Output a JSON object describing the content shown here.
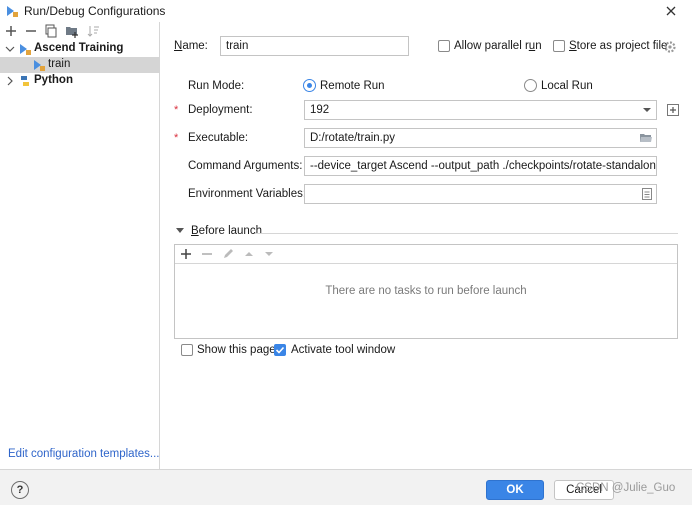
{
  "window": {
    "title": "Run/Debug Configurations"
  },
  "sidebar": {
    "tree": [
      {
        "label": "Ascend Training",
        "expanded": true,
        "children": [
          {
            "label": "train",
            "selected": true
          }
        ]
      },
      {
        "label": "Python",
        "expanded": false
      }
    ],
    "edit_templates_link": "Edit configuration templates..."
  },
  "form": {
    "name_label_mnemonic": "N",
    "name_label_rest": "ame:",
    "name_value": "train",
    "allow_parallel_run_pre": "Allow parallel r",
    "allow_parallel_run_mnemonic": "u",
    "allow_parallel_run_post": "n",
    "allow_parallel_run_checked": false,
    "store_as_project_file_mnemonic": "S",
    "store_as_project_file_rest": "tore as project file",
    "store_as_project_file_checked": false,
    "run_mode_label": "Run Mode:",
    "run_mode_options": [
      "Remote Run",
      "Local Run"
    ],
    "run_mode_selected": "Remote Run",
    "deployment_label": "Deployment:",
    "deployment_value": "192",
    "executable_label": "Executable:",
    "executable_value": "D:/rotate/train.py",
    "command_arguments_label": "Command Arguments:",
    "command_arguments_value": "--device_target Ascend --output_path ./checkpoints/rotate-standalone-as",
    "environment_variables_label": "Environment Variables:",
    "environment_variables_value": "",
    "required_marker": "*"
  },
  "before_launch": {
    "title_mnemonic": "B",
    "title_rest": "efore launch",
    "empty_text": "There are no tasks to run before launch"
  },
  "options": {
    "show_this_page_label": "Show this page",
    "show_this_page_checked": false,
    "activate_tool_window_label": "Activate tool window",
    "activate_tool_window_checked": true
  },
  "footer": {
    "help_label": "?",
    "ok_label": "OK",
    "cancel_label": "Cancel",
    "watermark": "CSDN @Julie_Guo"
  },
  "icons": {
    "app": "run-debug-icon",
    "close": "close-icon",
    "add": "plus-icon",
    "remove": "minus-icon",
    "copy": "copy-icon",
    "folder": "new-folder-icon",
    "sort": "sort-icon",
    "gear": "gear-icon",
    "expand_add": "plus-box-icon",
    "browse": "folder-open-icon",
    "env_edit": "document-icon"
  },
  "colors": {
    "accent": "#3a85e6",
    "required": "#d9303e",
    "link": "#2f65ca",
    "selection": "#d5d5d5"
  }
}
